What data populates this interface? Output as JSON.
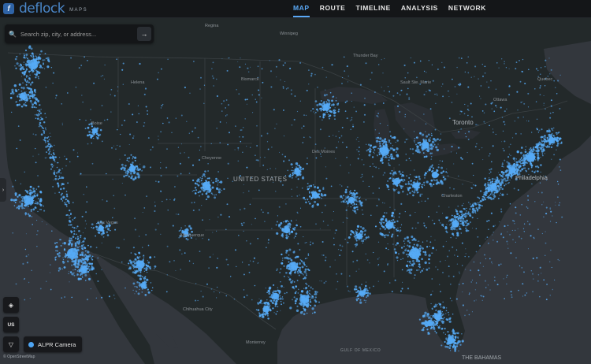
{
  "header": {
    "logo_mark": "f",
    "logo_word": "deflock",
    "logo_sub": "MAPS",
    "nav": [
      {
        "label": "MAP",
        "active": true
      },
      {
        "label": "ROUTE",
        "active": false
      },
      {
        "label": "TIMELINE",
        "active": false
      },
      {
        "label": "ANALYSIS",
        "active": false
      },
      {
        "label": "NETWORK",
        "active": false
      }
    ]
  },
  "search": {
    "placeholder": "Search zip, city, or address...",
    "search_glyph": "🔍",
    "go_glyph": "→"
  },
  "side_toggle": {
    "glyph": "›"
  },
  "controls": {
    "layers_glyph": "◈",
    "region_label": "US",
    "filter_glyph": "▽"
  },
  "legend": {
    "label": "ALPR Camera",
    "color": "#4ea5f3"
  },
  "attribution": "© OpenStreetMap",
  "map": {
    "colors": {
      "land": "#23292a",
      "water": "#33373d",
      "lake": "#2b2f34",
      "camera": "#56aaf5",
      "border": "#3b4144",
      "label": "#8a9095"
    },
    "labels": [
      {
        "text": "Regina",
        "size": "small"
      },
      {
        "text": "Winnipeg",
        "size": "small"
      },
      {
        "text": "Thunder Bay",
        "size": "small"
      },
      {
        "text": "Sault Ste. Marie",
        "size": "small"
      },
      {
        "text": "Quebec",
        "size": "small"
      },
      {
        "text": "Ottawa",
        "size": "small"
      },
      {
        "text": "Toronto",
        "size": "large"
      },
      {
        "text": "Helena",
        "size": "small"
      },
      {
        "text": "Bismarck",
        "size": "small"
      },
      {
        "text": "Boise",
        "size": "small"
      },
      {
        "text": "Cheyenne",
        "size": "small"
      },
      {
        "text": "Des Moines",
        "size": "small"
      },
      {
        "text": "UNITED STATES",
        "size": "country"
      },
      {
        "text": "Philadelphia",
        "size": "large"
      },
      {
        "text": "Charleston",
        "size": "small"
      },
      {
        "text": "Las Vegas",
        "size": "small"
      },
      {
        "text": "Albuquerque",
        "size": "small"
      },
      {
        "text": "Chihuahua City",
        "size": "small"
      },
      {
        "text": "Monterrey",
        "size": "small"
      },
      {
        "text": "GULF OF MEXICO",
        "size": "water"
      },
      {
        "text": "THE BAHAMAS",
        "size": "country"
      }
    ],
    "clusters": [
      {
        "name": "Seattle",
        "weight": 9
      },
      {
        "name": "Portland",
        "weight": 6
      },
      {
        "name": "San Francisco Bay",
        "weight": 8
      },
      {
        "name": "Los Angeles",
        "weight": 10
      },
      {
        "name": "San Diego",
        "weight": 6
      },
      {
        "name": "Phoenix",
        "weight": 7
      },
      {
        "name": "Denver",
        "weight": 7
      },
      {
        "name": "Salt Lake City",
        "weight": 5
      },
      {
        "name": "Dallas",
        "weight": 8
      },
      {
        "name": "Houston",
        "weight": 8
      },
      {
        "name": "Austin",
        "weight": 5
      },
      {
        "name": "San Antonio",
        "weight": 5
      },
      {
        "name": "Minneapolis",
        "weight": 6
      },
      {
        "name": "Chicago",
        "weight": 8
      },
      {
        "name": "Detroit",
        "weight": 6
      },
      {
        "name": "Atlanta",
        "weight": 10
      },
      {
        "name": "Charlotte",
        "weight": 6
      },
      {
        "name": "Washington",
        "weight": 6
      },
      {
        "name": "Philadelphia",
        "weight": 6
      },
      {
        "name": "New York",
        "weight": 7
      },
      {
        "name": "Orlando",
        "weight": 6
      },
      {
        "name": "Miami",
        "weight": 6
      },
      {
        "name": "Tampa",
        "weight": 5
      },
      {
        "name": "Kansas City",
        "weight": 5
      },
      {
        "name": "St. Louis",
        "weight": 5
      },
      {
        "name": "Nashville",
        "weight": 6
      },
      {
        "name": "Oklahoma City",
        "weight": 5
      },
      {
        "name": "Columbus",
        "weight": 5
      },
      {
        "name": "Indianapolis",
        "weight": 5
      },
      {
        "name": "Cincinnati",
        "weight": 4
      },
      {
        "name": "Memphis",
        "weight": 4
      },
      {
        "name": "New Orleans",
        "weight": 4
      },
      {
        "name": "Omaha",
        "weight": 4
      },
      {
        "name": "Boise",
        "weight": 3
      },
      {
        "name": "Albuquerque",
        "weight": 3
      },
      {
        "name": "Tucson",
        "weight": 4
      },
      {
        "name": "Las Vegas",
        "weight": 4
      },
      {
        "name": "Boston",
        "weight": 5
      }
    ]
  }
}
